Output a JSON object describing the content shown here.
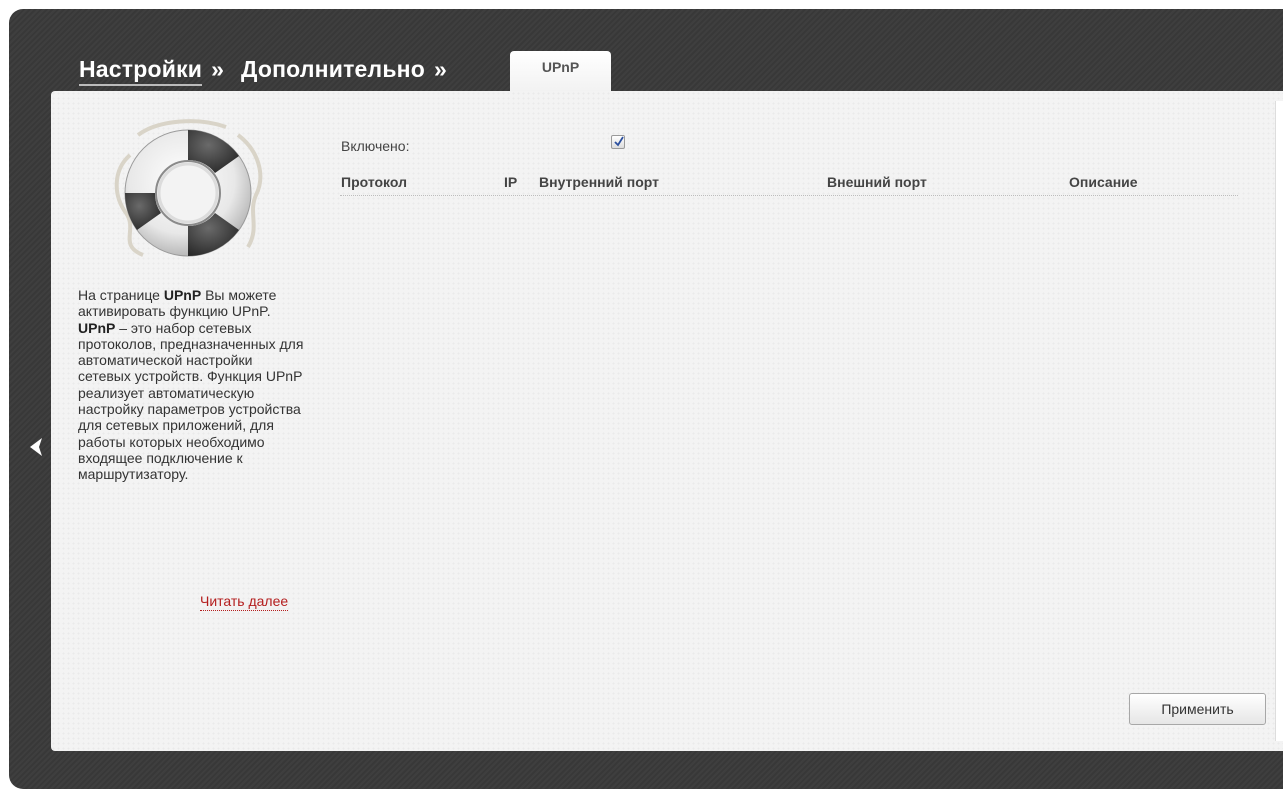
{
  "breadcrumb": {
    "settings": "Настройки",
    "advanced": "Дополнительно",
    "separator": "»"
  },
  "tab": {
    "label": "UPnP"
  },
  "help": {
    "icon": "lifebuoy-icon",
    "bold_term": "UPnP",
    "p1_prefix": "На странице ",
    "p1_suffix": " Вы можете активировать функцию UPnP.",
    "p2_suffix": " – это набор сетевых протоколов, предназначенных для автоматической настройки сетевых устройств. Функция UPnP реализует автоматическую настройку параметров устройства для сетевых приложений, для работы которых необходимо входящее подключение к маршрутизатору.",
    "read_more": "Читать далее"
  },
  "form": {
    "enabled_label": "Включено:",
    "enabled_checked": true
  },
  "table": {
    "columns": [
      "Протокол",
      "IP",
      "Внутренний порт",
      "Внешний порт",
      "Описание"
    ],
    "rows": []
  },
  "buttons": {
    "apply": "Применить"
  },
  "colors": {
    "frame": "#3a3a3a",
    "panel": "#f3f3f3",
    "link": "#b41e1e"
  }
}
